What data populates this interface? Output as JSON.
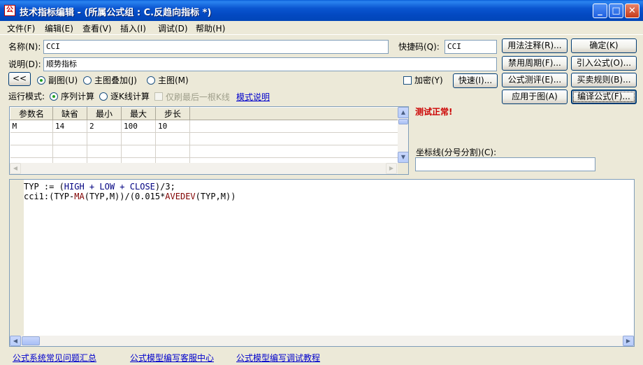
{
  "window": {
    "title": "技术指标编辑 - (所属公式组 : C.反趋向指标 *)",
    "icon_label": "公"
  },
  "menu": [
    {
      "label": "文件(F)"
    },
    {
      "label": "编辑(E)"
    },
    {
      "label": "查看(V)"
    },
    {
      "label": "插入(I)"
    },
    {
      "label": "调试(D)"
    },
    {
      "label": "帮助(H)"
    }
  ],
  "form": {
    "name_label": "名称(N):",
    "name_value": "CCI",
    "shortcut_label": "快捷码(Q):",
    "shortcut_value": "CCI",
    "desc_label": "说明(D):",
    "desc_value": "顺势指标",
    "collapse_label": "<<",
    "radio_sub": "副图(U)",
    "radio_main_overlay": "主图叠加(J)",
    "radio_main": "主图(M)",
    "encrypt_label": "加密(Y)",
    "quick_button": "快速(I)...",
    "run_mode_label": "运行模式:",
    "mode_sequence": "序列计算",
    "mode_kline": "逐K线计算",
    "only_last_label": "仅刷最后一根K线",
    "mode_help_link": "模式说明"
  },
  "buttons": {
    "usage_note": "用法注释(R)...",
    "ok": "确定(K)",
    "disable_period": "禁用周期(F)...",
    "import_formula": "引入公式(O)...",
    "formula_eval": "公式测评(E)...",
    "trade_rules": "买卖规则(B)...",
    "apply_chart": "应用于图(A)",
    "compile": "编译公式(F)..."
  },
  "status": {
    "test_message": "测试正常!",
    "test_color": "#cc0000",
    "axis_label": "坐标线(分号分割)(C):",
    "axis_value": ""
  },
  "params": {
    "headers": [
      "参数名",
      "缺省",
      "最小",
      "最大",
      "步长"
    ],
    "rows": [
      [
        "M",
        "14",
        "2",
        "100",
        "10"
      ],
      [
        "",
        "",
        "",
        "",
        ""
      ],
      [
        "",
        "",
        "",
        "",
        ""
      ],
      [
        "",
        "",
        "",
        "",
        ""
      ]
    ]
  },
  "code": {
    "line1": {
      "a": "TYP := (",
      "b": "HIGH",
      "c": " + ",
      "d": "LOW",
      "e": " + ",
      "f": "CLOSE",
      "g": ")/3;"
    },
    "line2": {
      "a": "cci1:(TYP-",
      "b": "MA",
      "c": "(TYP,M))/(0.015*",
      "d": "AVEDEV",
      "e": "(TYP,M))"
    }
  },
  "footer_links": [
    {
      "label": "公式系统常见问题汇总"
    },
    {
      "label": "公式模型编写客服中心"
    },
    {
      "label": "公式模型编写调试教程"
    }
  ]
}
